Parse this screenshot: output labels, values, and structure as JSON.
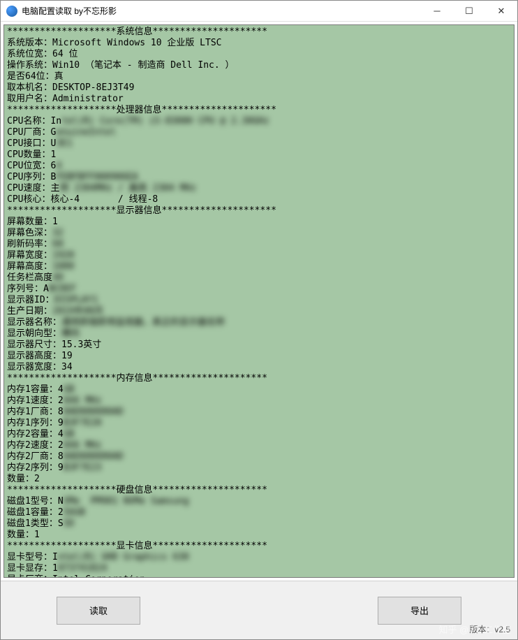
{
  "window": {
    "title": "电脑配置读取    by不忘形影"
  },
  "sections": {
    "system": {
      "header": "********************系统信息*********************",
      "lines": [
        {
          "label": "系统版本：",
          "value": "Microsoft Windows 10 企业版 LTSC",
          "blur": false
        },
        {
          "label": "系统位宽：",
          "value": "64 位",
          "blur": false
        },
        {
          "label": "操作系统：",
          "value": "Win10 （笔记本 - 制造商 Dell Inc. ）",
          "blur": false
        },
        {
          "label": "是否64位：",
          "value": "真",
          "blur": false
        },
        {
          "label": "取本机名：",
          "value": "DESKTOP-8EJ3T49",
          "blur": false
        },
        {
          "label": "取用户名：",
          "value": "Administrator",
          "blur": false
        }
      ]
    },
    "cpu": {
      "header": "********************处理器信息*********************",
      "lines": [
        {
          "label": "CPU名称：",
          "value": "Intel(R) Core(TM) i5-8300H CPU @ 2.30GHz",
          "blur": true,
          "prefix": "In"
        },
        {
          "label": "CPU厂商：",
          "value": "GenuineIntel",
          "blur": true,
          "prefix": "G"
        },
        {
          "label": "CPU接口：",
          "value": "U3E1",
          "blur": true,
          "prefix": "U"
        },
        {
          "label": "CPU数量：",
          "value": "1",
          "blur": false
        },
        {
          "label": "CPU位宽：",
          "value": "64",
          "blur": true,
          "prefix": "6"
        },
        {
          "label": "CPU序列：",
          "value": "BFEBFBFF000906EA",
          "blur": true,
          "prefix": "B"
        },
        {
          "label": "CPU速度：",
          "value": "主频 2304MHz / 最高 2304 MHz",
          "blur": true,
          "prefix": "主"
        },
        {
          "label": "CPU核心：",
          "value": "核心-4       / 线程-8",
          "blur": false
        }
      ]
    },
    "display": {
      "header": "********************显示器信息*********************",
      "lines": [
        {
          "label": "屏幕数量：",
          "value": "1",
          "blur": false
        },
        {
          "label": "屏幕色深：",
          "value": "32",
          "blur": true,
          "prefix": ""
        },
        {
          "label": "刷新码率：",
          "value": "60",
          "blur": true,
          "prefix": ""
        },
        {
          "label": "屏幕宽度：",
          "value": "1920",
          "blur": true,
          "prefix": ""
        },
        {
          "label": "屏幕高度：",
          "value": "1080",
          "blur": true,
          "prefix": ""
        },
        {
          "label": "任务栏高度",
          "value": "40",
          "blur": true,
          "prefix": ""
        },
        {
          "label": "序列号：",
          "value": "ABCDEF",
          "blur": true,
          "prefix": "A"
        },
        {
          "label": "显示器ID：",
          "value": "DISPLAY1",
          "blur": true,
          "prefix": ""
        },
        {
          "label": "生产日期：",
          "value": "2019年08月",
          "blur": true,
          "prefix": ""
        },
        {
          "label": "显示器名称：",
          "value": "通用即插即用监视器，真正的显示器名称",
          "blur": true,
          "prefix": ""
        },
        {
          "label": "显示朝向型：",
          "value": "横向",
          "blur": true,
          "prefix": ""
        },
        {
          "label": "显示器尺寸：",
          "value": "15.3英寸",
          "blur": false
        },
        {
          "label": "显示器高度：",
          "value": "19",
          "blur": false
        },
        {
          "label": "显示器宽度：",
          "value": "34",
          "blur": false
        }
      ]
    },
    "memory": {
      "header": "********************内存信息*********************",
      "lines": [
        {
          "label": "内存1容量：",
          "value": "4GB",
          "blur": true,
          "prefix": "4"
        },
        {
          "label": "内存1速度：",
          "value": "2666 MHz",
          "blur": true,
          "prefix": "2"
        },
        {
          "label": "内存1厂商：",
          "value": "80AD000080AD",
          "blur": true,
          "prefix": "8"
        },
        {
          "label": "内存1序列：",
          "value": "9B3F7E20",
          "blur": true,
          "prefix": "9"
        },
        {
          "label": "内存2容量：",
          "value": "4GB",
          "blur": true,
          "prefix": "4"
        },
        {
          "label": "内存2速度：",
          "value": "2666 MHz",
          "blur": true,
          "prefix": "2"
        },
        {
          "label": "内存2厂商：",
          "value": "80AD000080AD",
          "blur": true,
          "prefix": "8"
        },
        {
          "label": "内存2序列：",
          "value": "9B3F7E23",
          "blur": true,
          "prefix": "9"
        },
        {
          "label": "数量：",
          "value": "2",
          "blur": false
        }
      ]
    },
    "disk": {
      "header": "********************硬盘信息*********************",
      "lines": [
        {
          "label": "磁盘1型号：",
          "value": "NVMe  PM981 NVMe Samsung",
          "blur": true,
          "prefix": "N"
        },
        {
          "label": "磁盘1容量：",
          "value": "256GB",
          "blur": true,
          "prefix": "2"
        },
        {
          "label": "磁盘1类型：",
          "value": "SSD",
          "blur": true,
          "prefix": "S"
        },
        {
          "label": "数量：",
          "value": "1",
          "blur": false
        }
      ]
    },
    "gpu": {
      "header": "********************显卡信息*********************",
      "lines": [
        {
          "label": "显卡型号：",
          "value": "Intel(R) UHD Graphics 630",
          "blur": true,
          "prefix": "I"
        },
        {
          "label": "显卡显存：",
          "value": "1073741824",
          "blur": true,
          "prefix": "1"
        },
        {
          "label": "显卡厂商：",
          "value": "Intel Corporation",
          "blur": false
        }
      ]
    }
  },
  "buttons": {
    "read": "读取",
    "export": "导出"
  },
  "version": "版本：v2.5",
  "watermark": "知乎 @老Y工作室"
}
